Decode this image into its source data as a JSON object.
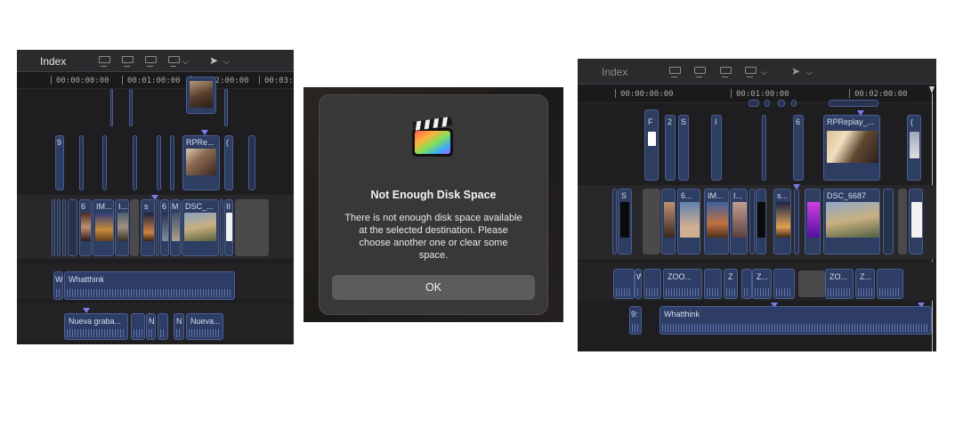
{
  "left_panel": {
    "index_label": "Index",
    "timecodes": [
      "00:00:00:00",
      "00:01:00:00",
      "00:02:00:00",
      "00:03:0"
    ],
    "connected_clips": [
      {
        "label": "9"
      },
      {
        "label": "RPRe..."
      },
      {
        "label": "("
      }
    ],
    "primary_clips": [
      {
        "label": "6"
      },
      {
        "label": "IM..."
      },
      {
        "label": "I..."
      },
      {
        "label": "s"
      },
      {
        "label": "6"
      },
      {
        "label": "M"
      },
      {
        "label": "DSC_..."
      },
      {
        "label": "II"
      }
    ],
    "audio_clips": [
      {
        "label": "W"
      },
      {
        "label": "Whatthink"
      },
      {
        "label": "Nueva graba..."
      },
      {
        "label": "N"
      },
      {
        "label": "N"
      },
      {
        "label": "Nueva..."
      }
    ]
  },
  "dialog": {
    "title": "Not Enough Disk Space",
    "message": "There is not enough disk space available\nat the selected destination. Please\nchoose another one or clear some\nspace.",
    "ok_label": "OK",
    "icon": "final-cut-pro-app-icon"
  },
  "right_panel": {
    "index_label": "Index",
    "timecodes": [
      "00:00:00:00",
      "00:01:00:00",
      "00:02:00:00"
    ],
    "connected_clips": [
      {
        "label": "F"
      },
      {
        "label": "2"
      },
      {
        "label": "S"
      },
      {
        "label": "I"
      },
      {
        "label": "6"
      },
      {
        "label": "RPReplay_..."
      },
      {
        "label": "("
      }
    ],
    "primary_clips": [
      {
        "label": "S"
      },
      {
        "label": "6..."
      },
      {
        "label": "IM..."
      },
      {
        "label": "I..."
      },
      {
        "label": "s..."
      },
      {
        "label": "DSC_6687"
      }
    ],
    "audio_clips": [
      {
        "label": "W"
      },
      {
        "label": "ZOO..."
      },
      {
        "label": "Z"
      },
      {
        "label": "Z..."
      },
      {
        "label": "ZO..."
      },
      {
        "label": "Z..."
      },
      {
        "label": "9:"
      },
      {
        "label": "Whatthink"
      }
    ]
  },
  "colors": {
    "clip_blue": "#2e3d62",
    "marker_purple": "#7b7bf2",
    "timeline_bg": "#1e1e20"
  }
}
